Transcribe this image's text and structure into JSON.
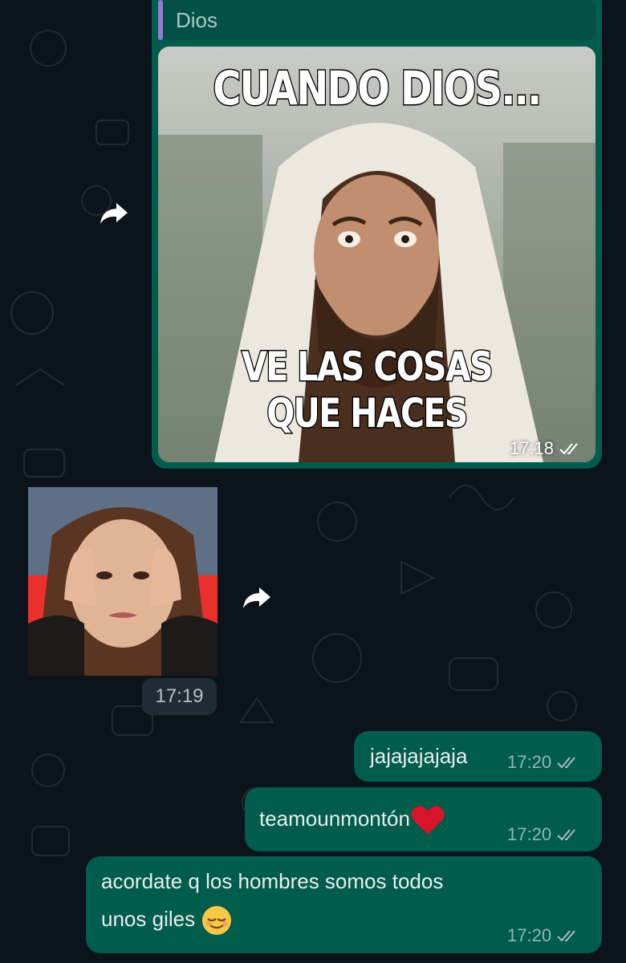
{
  "chat": {
    "quoted_message": {
      "label": "Dios"
    },
    "meme": {
      "top_caption": "CUANDO DIOS...",
      "bottom_caption_line1": "VE LAS COSAS",
      "bottom_caption_line2": "QUE HACES",
      "time": "17:18",
      "status": "read"
    },
    "sticker": {
      "time": "17:19"
    },
    "messages": [
      {
        "text": "jajajajajaja",
        "time": "17:20",
        "status": "read"
      },
      {
        "text": "teamounmontón",
        "emoji": "red-heart",
        "time": "17:20",
        "status": "read"
      },
      {
        "line1": "acordate q los hombres somos todos",
        "line2": "unos giles",
        "emoji": "relieved-face",
        "time": "17:20",
        "status": "read"
      }
    ]
  },
  "colors": {
    "background": "#0b141a",
    "outgoing_bubble": "#005c4b",
    "incoming_bubble": "#1f2c34",
    "quote_accent": "#8f7fd1",
    "text": "#e9edef"
  },
  "icons": [
    "forward-icon",
    "double-check-icon",
    "red-heart-emoji",
    "relieved-face-emoji"
  ]
}
